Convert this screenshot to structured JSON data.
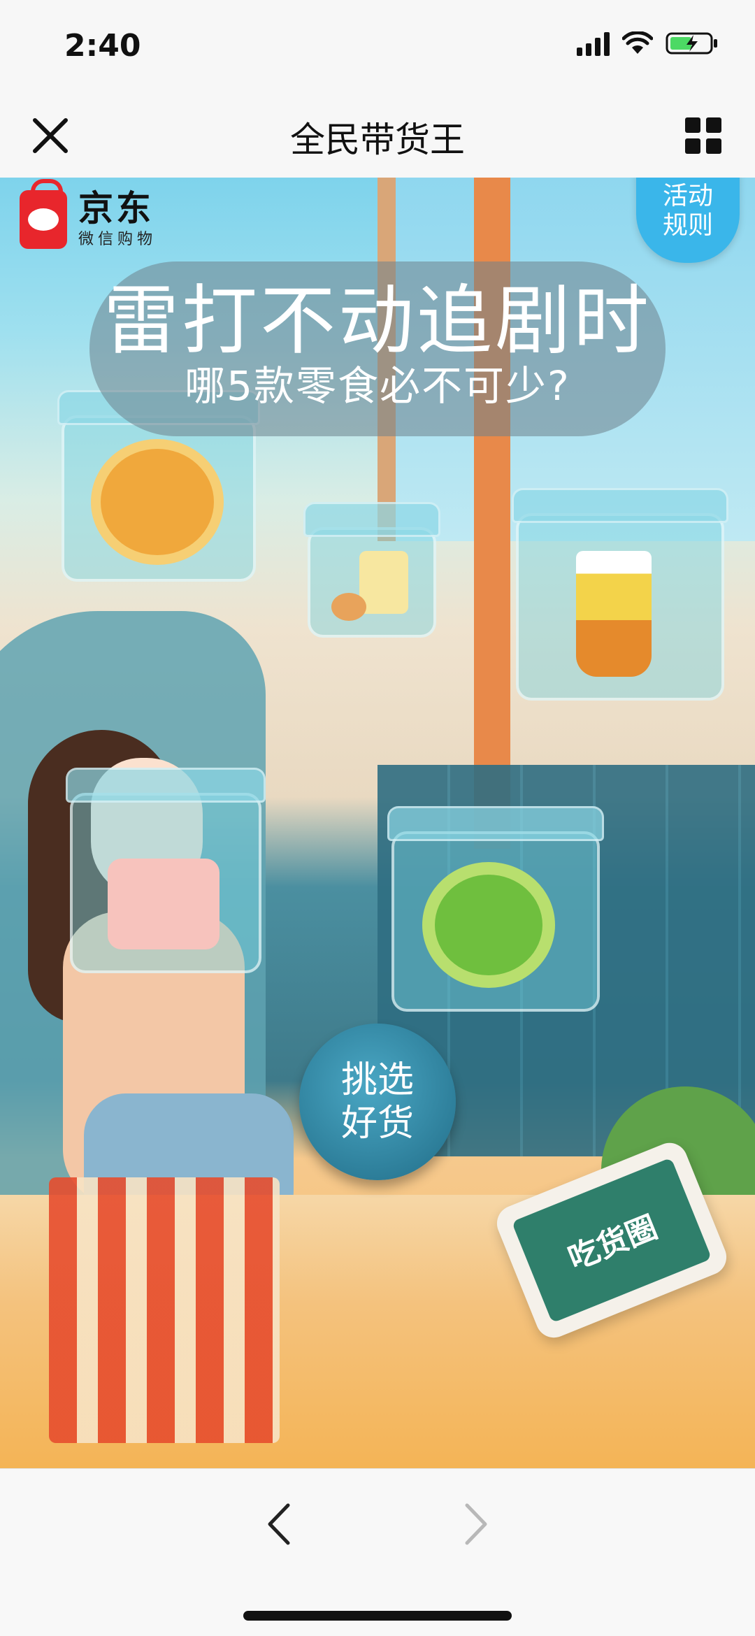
{
  "status_bar": {
    "time": "2:40",
    "icons": [
      "signal-icon",
      "wifi-icon",
      "battery-charging-icon"
    ]
  },
  "nav": {
    "title": "全民带货王",
    "close_icon": "close-icon",
    "more_icon": "grid-menu-icon"
  },
  "banner": {
    "logo_main": "京东",
    "logo_sub": "微信购物",
    "rules_label_line1": "活动",
    "rules_label_line2": "规则",
    "headline": "雷打不动追剧时",
    "subheadline": "哪5款零食必不可少?",
    "pick_button_line1": "挑选",
    "pick_button_line2": "好货",
    "tablet_text": "吃货圈"
  },
  "bottom_bar": {
    "back_icon": "chevron-left-icon",
    "forward_icon": "chevron-right-icon"
  },
  "colors": {
    "accent_red": "#e8262c",
    "rules_blue": "#3ab6ea",
    "button_teal": "#216d88",
    "floor_orange": "#f4b456"
  }
}
